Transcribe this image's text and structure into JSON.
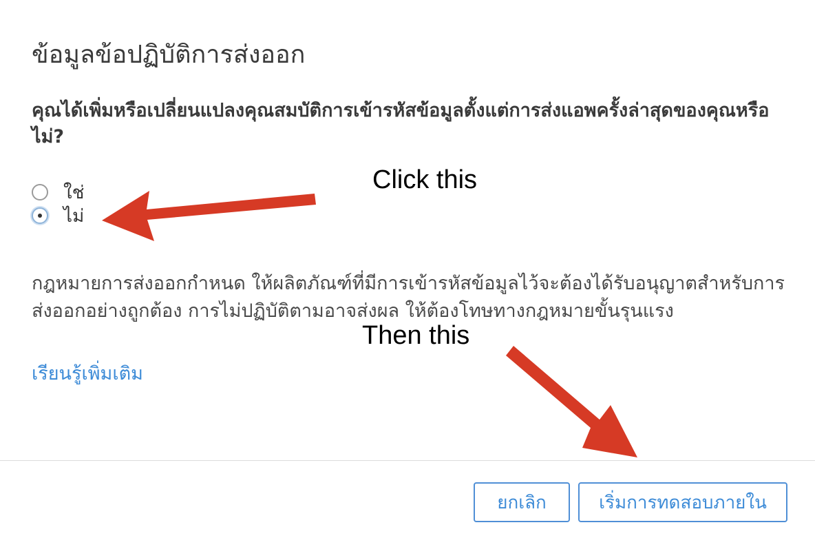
{
  "dialog": {
    "title": "ข้อมูลข้อปฏิบัติการส่งออก",
    "question": "คุณได้เพิ่มหรือเปลี่ยนแปลงคุณสมบัติการเข้ารหัสข้อมูลตั้งแต่การส่งแอพครั้งล่าสุดของคุณหรือไม่?",
    "options": [
      {
        "label": "ใช่",
        "checked": false
      },
      {
        "label": "ไม่",
        "checked": true
      }
    ],
    "legal_text": "กฎหมายการส่งออกกำหนด ให้ผลิตภัณฑ์ที่มีการเข้ารหัสข้อมูลไว้จะต้องได้รับอนุญาตสำหรับการส่งออกอย่างถูกต้อง การไม่ปฏิบัติตามอาจส่งผล ให้ต้องโทษทางกฎหมายขั้นรุนแรง",
    "learn_more": "เรียนรู้เพิ่มเติม",
    "cancel_label": "ยกเลิก",
    "start_label": "เริ่มการทดสอบภายใน"
  },
  "annotations": {
    "click_this": "Click this",
    "then_this": "Then this",
    "arrow_color": "#d63a25"
  },
  "colors": {
    "link": "#3d8bd7",
    "button_border": "#4f8fd6",
    "text": "#3a3a3a"
  }
}
